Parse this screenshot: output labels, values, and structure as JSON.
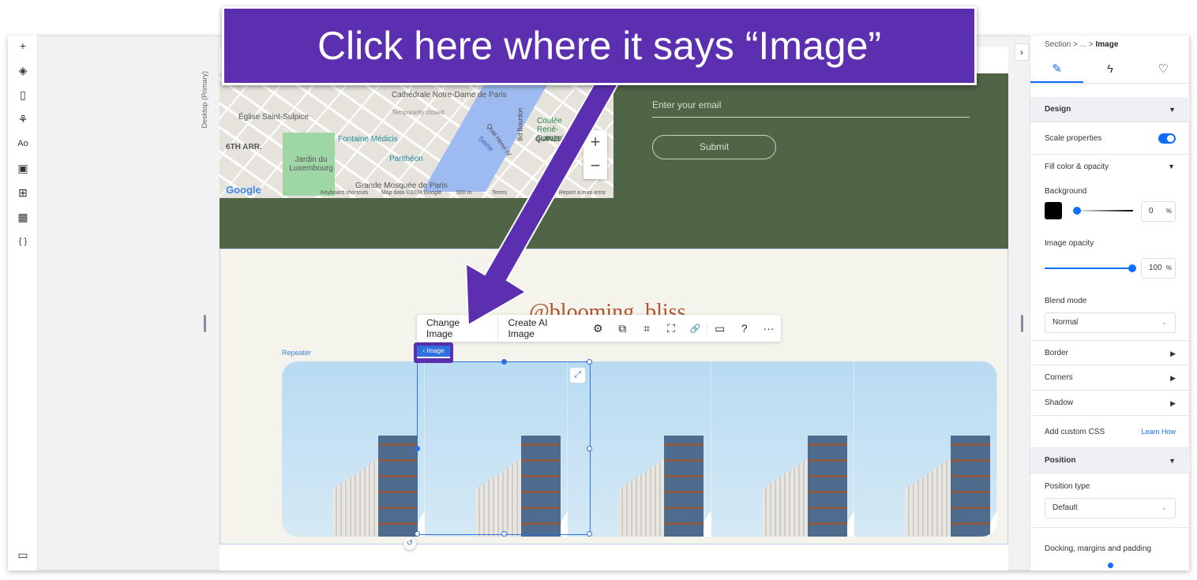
{
  "banner": {
    "text": "Click here where it says “Image”",
    "color": "#5b2fb0"
  },
  "left_toolbar": {
    "icons": [
      "plus-icon",
      "layers-icon",
      "pages-icon",
      "apps-icon",
      "text-theme-icon",
      "media-icon",
      "add-apps-icon",
      "cms-table-icon",
      "code-icon",
      "comments-icon"
    ],
    "glyphs": [
      "+",
      "◈",
      "▯",
      "⚘",
      "Aᴏ",
      "▣",
      "⊞",
      "▦",
      "{ }",
      "▭"
    ]
  },
  "canvas": {
    "viewport_label": "Desktop (Primary)"
  },
  "map": {
    "labels": [
      "Cathédrale Notre-Dame de Paris",
      "Temporarily closed",
      "Église Saint-Sulpice",
      "6TH ARR.",
      "Fontaine Médicis",
      "Jardin du Luxembourg",
      "Panthéon",
      "Grande Mosquée de Paris",
      "Coulée René-Dumont",
      "QUINZE-VINGTS",
      "Seine",
      "Quai Henri IV",
      "Bd Bourdon"
    ],
    "footer": [
      "Google",
      "Keyboard shortcuts",
      "Map data ©2024 Google",
      "500 m",
      "Terms",
      "Report a map error"
    ],
    "zoom_in": "+",
    "zoom_out": "−"
  },
  "form": {
    "email_placeholder": "Enter your email",
    "submit_label": "Submit"
  },
  "section": {
    "heading": "@blooming_bliss",
    "repeater_label": "Repeater",
    "image_tag": "‹ Image"
  },
  "toolbar": {
    "change_image": "Change Image",
    "create_ai_image": "Create AI Image",
    "icons": [
      "settings-icon",
      "duplicate-icon",
      "crop-icon",
      "focal-point-icon",
      "link-icon",
      "comment-icon",
      "help-icon",
      "more-icon"
    ],
    "glyphs": [
      "⚙",
      "⧉",
      "⌗",
      "⛶",
      "🔗",
      "▭",
      "?",
      "···"
    ]
  },
  "panel": {
    "breadcrumb": [
      "Section",
      "...",
      "Image"
    ],
    "tabs": [
      "design-tab",
      "interactions-tab",
      "tips-tab"
    ],
    "design": {
      "title": "Design",
      "scale_properties": "Scale properties",
      "scale_on": true,
      "fill_title": "Fill color & opacity",
      "background_label": "Background",
      "background_color": "#000000",
      "background_opacity": "0",
      "image_opacity_label": "Image opacity",
      "image_opacity": "100",
      "percent": "%",
      "blend_mode_label": "Blend mode",
      "blend_mode": "Normal"
    },
    "collapsibles": [
      "Border",
      "Corners",
      "Shadow"
    ],
    "custom_css": "Add custom CSS",
    "learn_how": "Learn How",
    "position": {
      "title": "Position",
      "type_label": "Position type",
      "type_value": "Default",
      "docking_label": "Docking, margins and padding"
    }
  },
  "accent": "#116dff"
}
